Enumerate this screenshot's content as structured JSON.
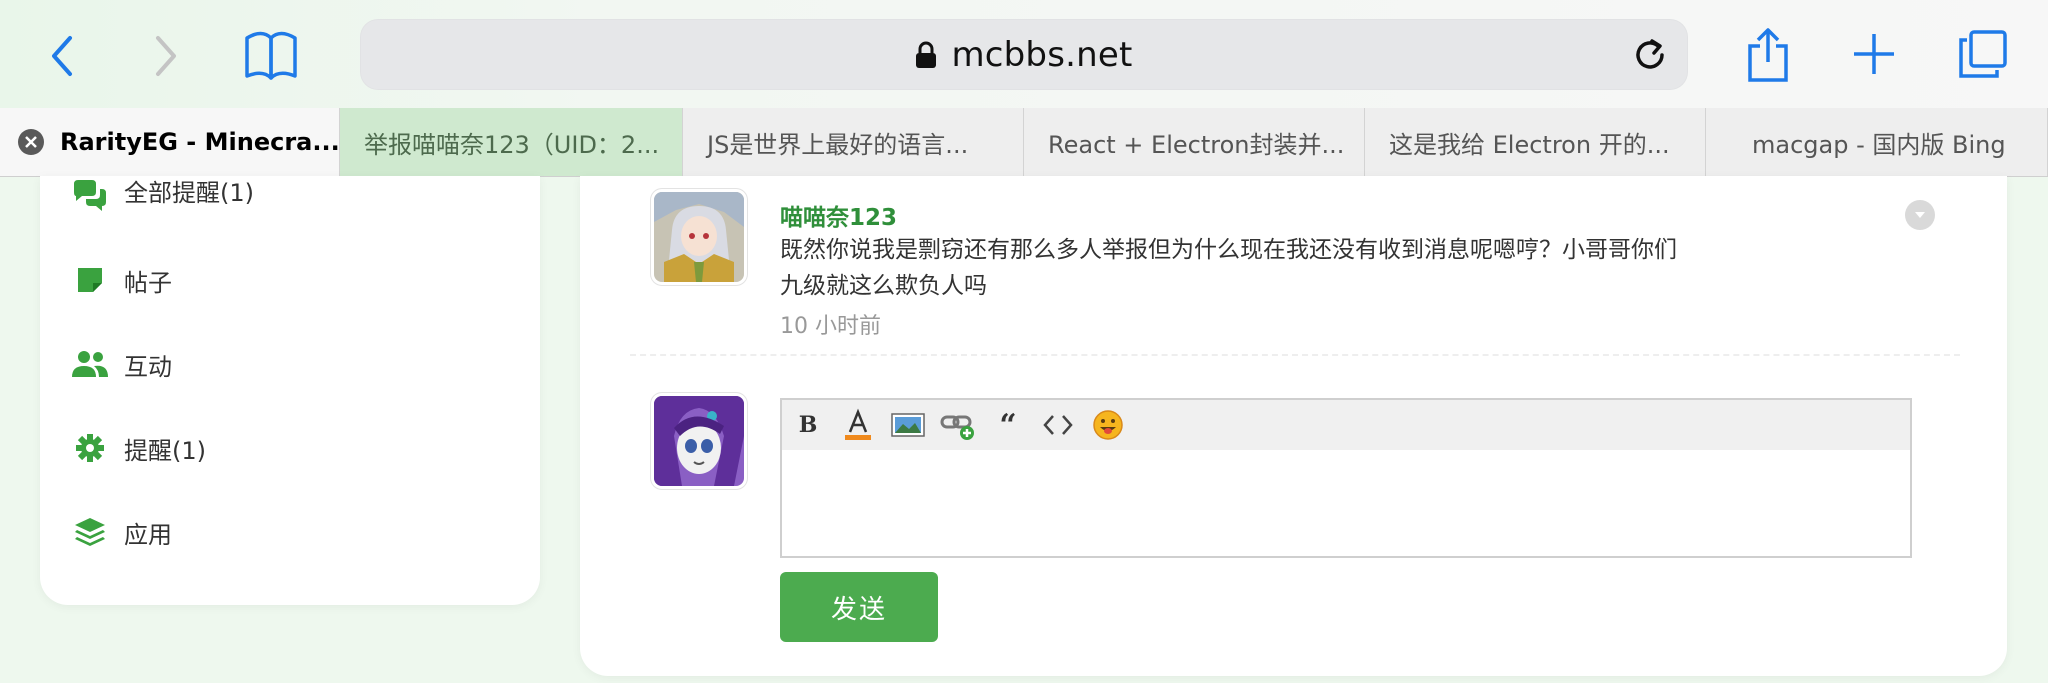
{
  "browser": {
    "url": "mcbbs.net",
    "tabs": [
      {
        "label": "RarityEG - Minecra..."
      },
      {
        "label": "举报喵喵奈123（UID：2..."
      },
      {
        "label": "JS是世界上最好的语言..."
      },
      {
        "label": "React + Electron封装并..."
      },
      {
        "label": "这是我给 Electron 开的..."
      },
      {
        "label": "macgap - 国内版 Bing"
      }
    ]
  },
  "sidebar": {
    "items": [
      {
        "label": "全部提醒(1)",
        "icon": "chat-bubbles-icon"
      },
      {
        "label": "帖子",
        "icon": "post-note-icon"
      },
      {
        "label": "互动",
        "icon": "users-icon"
      },
      {
        "label": "提醒(1)",
        "icon": "gear-icon"
      },
      {
        "label": "应用",
        "icon": "layers-icon"
      }
    ]
  },
  "comment": {
    "author": "喵喵奈123",
    "text_line1": "既然你说我是剽窃还有那么多人举报但为什么现在我还没有收到消息呢嗯哼？小哥哥你们",
    "text_line2": "九级就这么欺负人吗",
    "time": "10 小时前"
  },
  "editor": {
    "bold_label": "B",
    "quote_label": "“",
    "send_label": "发送"
  },
  "colors": {
    "accent": "#4cab4f",
    "author": "#2f8f3a",
    "ios_blue": "#1f7ae8"
  }
}
